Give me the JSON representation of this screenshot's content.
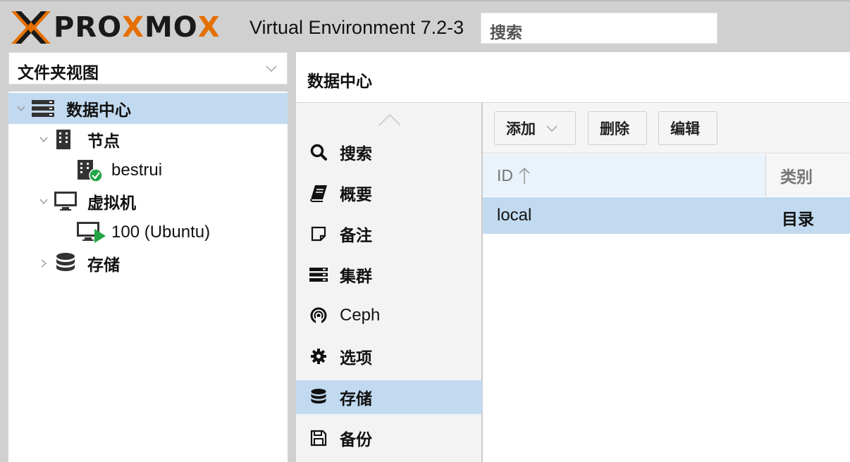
{
  "app": {
    "logo_left": "PRO",
    "logo_mid": "X",
    "logo_right": "MO",
    "logo_end": "X",
    "version": "Virtual Environment 7.2-3",
    "search_placeholder": "搜索",
    "brand_orange": "#e57000",
    "selection_color": "#c2daf0"
  },
  "sidebar": {
    "view_select": "文件夹视图",
    "tree": [
      {
        "label": "数据中心",
        "icon": "datacenter-icon"
      },
      {
        "label": "节点",
        "icon": "building-icon"
      },
      {
        "label": "bestrui",
        "icon": "node-online-icon"
      },
      {
        "label": "虚拟机",
        "icon": "monitor-icon"
      },
      {
        "label": "100 (Ubuntu)",
        "icon": "vm-running-icon"
      },
      {
        "label": "存储",
        "icon": "database-icon"
      }
    ]
  },
  "main": {
    "title": "数据中心",
    "menu": [
      {
        "label": "搜索",
        "icon": "search-icon"
      },
      {
        "label": "概要",
        "icon": "book-icon"
      },
      {
        "label": "备注",
        "icon": "note-icon"
      },
      {
        "label": "集群",
        "icon": "server-icon"
      },
      {
        "label": "Ceph",
        "icon": "ceph-icon"
      },
      {
        "label": "选项",
        "icon": "gear-icon"
      },
      {
        "label": "存储",
        "icon": "database-icon"
      },
      {
        "label": "备份",
        "icon": "floppy-icon"
      }
    ],
    "toolbar": {
      "add": "添加",
      "delete": "删除",
      "edit": "编辑"
    },
    "grid": {
      "columns": [
        "ID",
        "类别"
      ],
      "rows": [
        {
          "id": "local",
          "type": "目录"
        }
      ]
    }
  }
}
